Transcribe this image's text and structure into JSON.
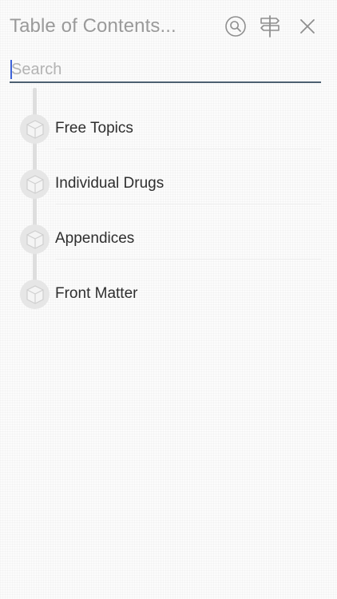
{
  "header": {
    "title": "Table of Contents...",
    "icons": [
      "search-icon",
      "signpost-icon",
      "close-icon"
    ]
  },
  "search": {
    "placeholder": "Search",
    "value": ""
  },
  "toc": {
    "items": [
      {
        "label": "Free Topics",
        "icon": "cube-icon"
      },
      {
        "label": "Individual Drugs",
        "icon": "cube-icon"
      },
      {
        "label": "Appendices",
        "icon": "cube-icon"
      },
      {
        "label": "Front Matter",
        "icon": "cube-icon"
      }
    ]
  },
  "colors": {
    "title": "#9a9a9a",
    "icon": "#8f8f8f",
    "search_underline": "#4c5f70",
    "caret": "#3e63d9",
    "node": "#e6e6e6",
    "rail": "#dedede"
  }
}
